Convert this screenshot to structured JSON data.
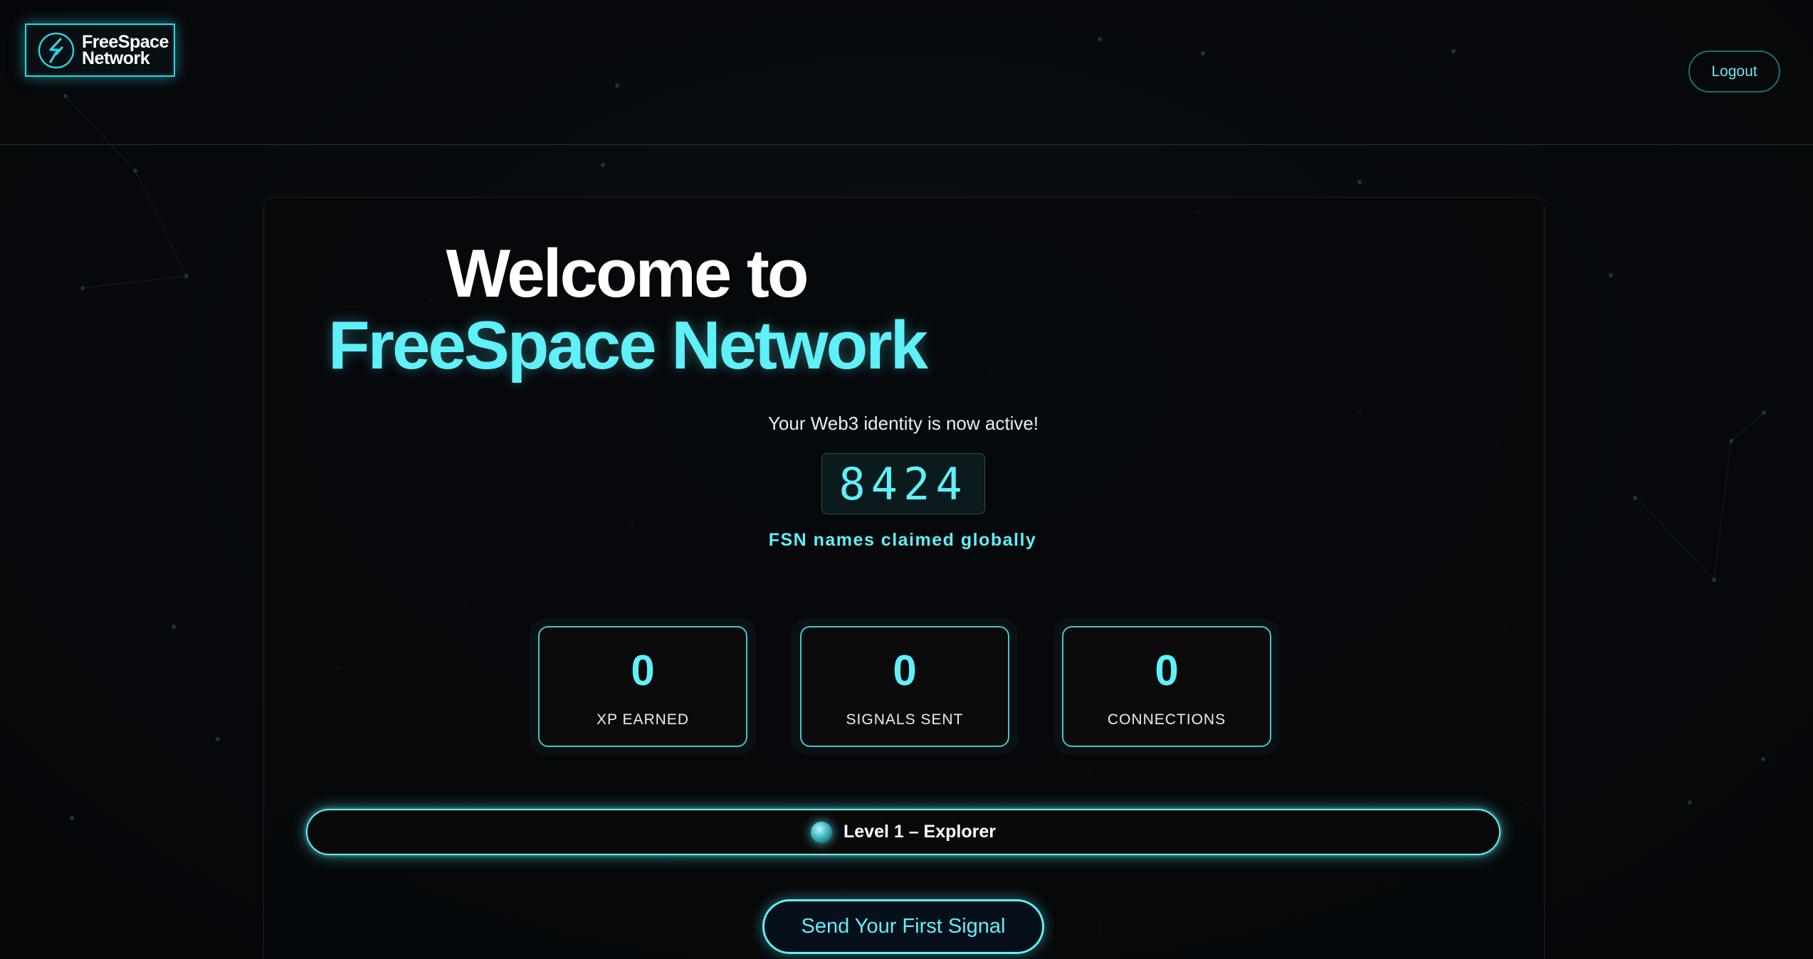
{
  "header": {
    "logo_line1": "FreeSpace",
    "logo_line2": "Network",
    "logo_icon": "fsn-bolt-logo-icon",
    "logout_label": "Logout"
  },
  "hero": {
    "title_line1": "Welcome to",
    "title_line2": "FreeSpace Network",
    "subtitle": "Your Web3 identity is now active!",
    "counter_value": "8424",
    "counter_label": "FSN names claimed globally"
  },
  "stats": [
    {
      "value": "0",
      "label": "XP EARNED"
    },
    {
      "value": "0",
      "label": "SIGNALS SENT"
    },
    {
      "value": "0",
      "label": "CONNECTIONS"
    }
  ],
  "level": {
    "icon": "level-orb-icon",
    "label": "Level 1 – Explorer"
  },
  "cta": {
    "label": "Send Your First Signal"
  },
  "colors": {
    "accent": "#5ff0f8",
    "background": "#07090c",
    "card_border": "#3fc6cf"
  }
}
